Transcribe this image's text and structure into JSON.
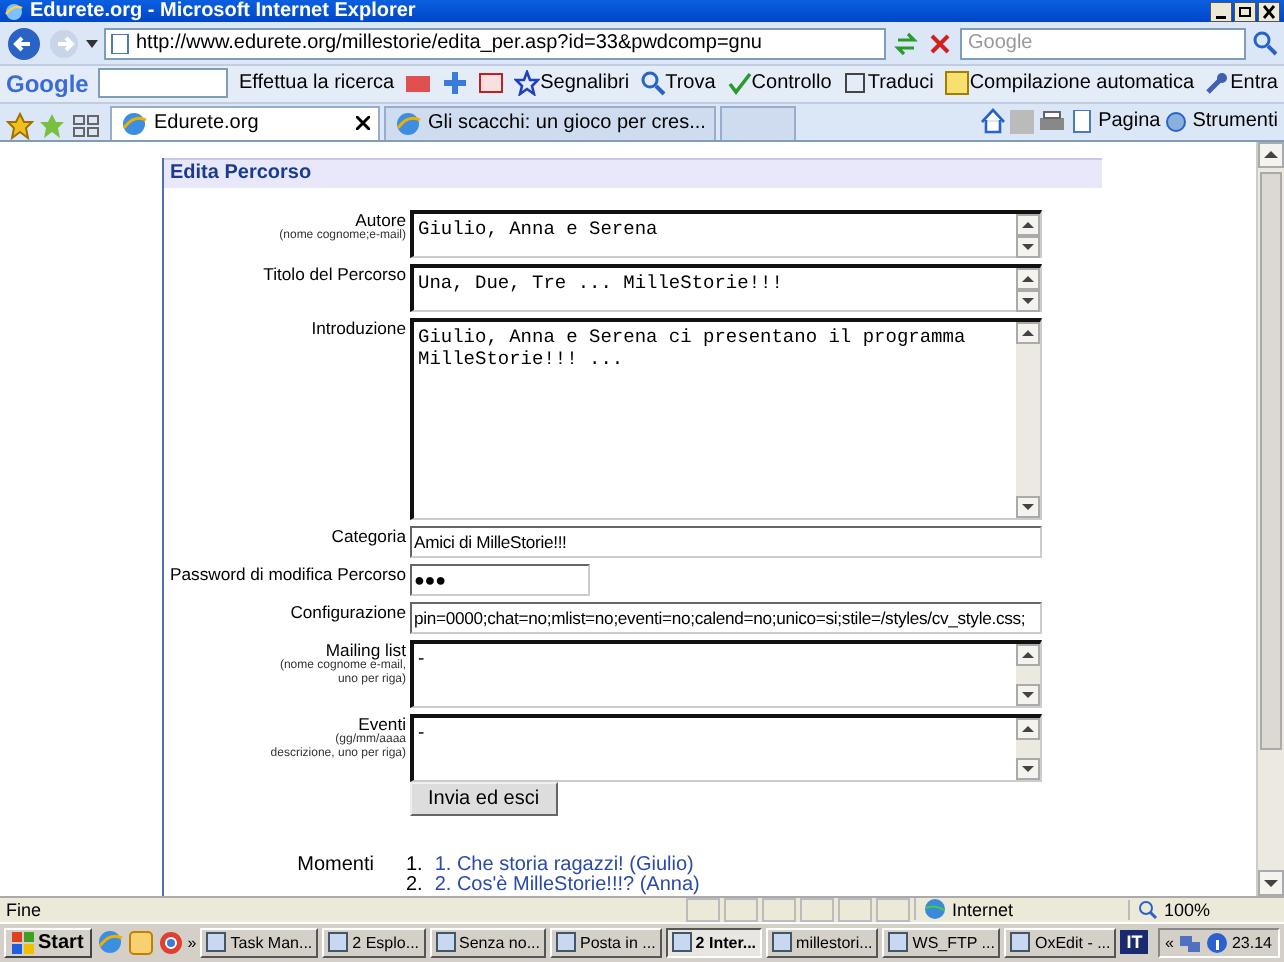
{
  "window": {
    "title": "Edurete.org - Microsoft Internet Explorer"
  },
  "address_bar": {
    "url": "http://www.edurete.org/millestorie/edita_per.asp?id=33&pwdcomp=gnu",
    "search_placeholder": "Google"
  },
  "google_toolbar": {
    "logo": "Google",
    "search_button": "Effettua la ricerca",
    "items": [
      "Segnalibri",
      "Trova",
      "Controllo",
      "Traduci",
      "Compilazione automatica",
      "Entra"
    ]
  },
  "tabs": [
    {
      "label": "Edurete.org",
      "selected": true
    },
    {
      "label": "Gli scacchi: un gioco per cres...",
      "selected": false
    }
  ],
  "command_bar": [
    "Pagina",
    "Strumenti"
  ],
  "form": {
    "title": "Edita Percorso",
    "fields": [
      {
        "kind": "short-text",
        "label": "Autore",
        "hint": "(nome cognome;e-mail)",
        "value": "Giulio, Anna e Serena"
      },
      {
        "kind": "short-text",
        "label": "Titolo del Percorso",
        "value": "Una, Due, Tre ... MilleStorie!!!"
      },
      {
        "kind": "long-text",
        "label": "Introduzione",
        "value": "Giulio, Anna e Serena ci presentano il programma MilleStorie!!! ..."
      },
      {
        "kind": "line",
        "label": "Categoria",
        "value": "Amici di MilleStorie!!!"
      },
      {
        "kind": "password",
        "label": "Password di modifica Percorso",
        "value": "●●●"
      },
      {
        "kind": "line",
        "label": "Configurazione",
        "value": "pin=0000;chat=no;mlist=no;eventi=no;calend=no;unico=si;stile=/styles/cv_style.css;"
      },
      {
        "kind": "list-text",
        "label": "Mailing list",
        "hint": "(nome cognome e-mail, uno per riga)",
        "value": "-"
      },
      {
        "kind": "list-text",
        "label": "Eventi",
        "hint": "(gg/mm/aaaa descrizione, uno per riga)",
        "value": "-"
      }
    ],
    "submit": "Invia ed esci",
    "moments": {
      "label": "Momenti",
      "items": [
        {
          "number": "1.",
          "text": "1. Che storia ragazzi! (Giulio)"
        },
        {
          "number": "2.",
          "text": "2. Cos'è MilleStorie!!!? (Anna)"
        }
      ]
    }
  },
  "status_bar": {
    "text": "Fine",
    "zone": "Internet",
    "zoom": "100%"
  },
  "taskbar": {
    "start": "Start",
    "more": "»",
    "tasks": [
      {
        "label": "Task Man...",
        "selected": false
      },
      {
        "label": "2 Esplo...",
        "selected": false
      },
      {
        "label": "Senza no...",
        "selected": false
      },
      {
        "label": "Posta in ...",
        "selected": false
      },
      {
        "label": "2 Inter...",
        "selected": true
      },
      {
        "label": "millestori...",
        "selected": false
      },
      {
        "label": "WS_FTP ...",
        "selected": false
      },
      {
        "label": "OxEdit - ...",
        "selected": false
      }
    ],
    "language": "IT",
    "tray_more": "«",
    "clock": "23.14"
  }
}
